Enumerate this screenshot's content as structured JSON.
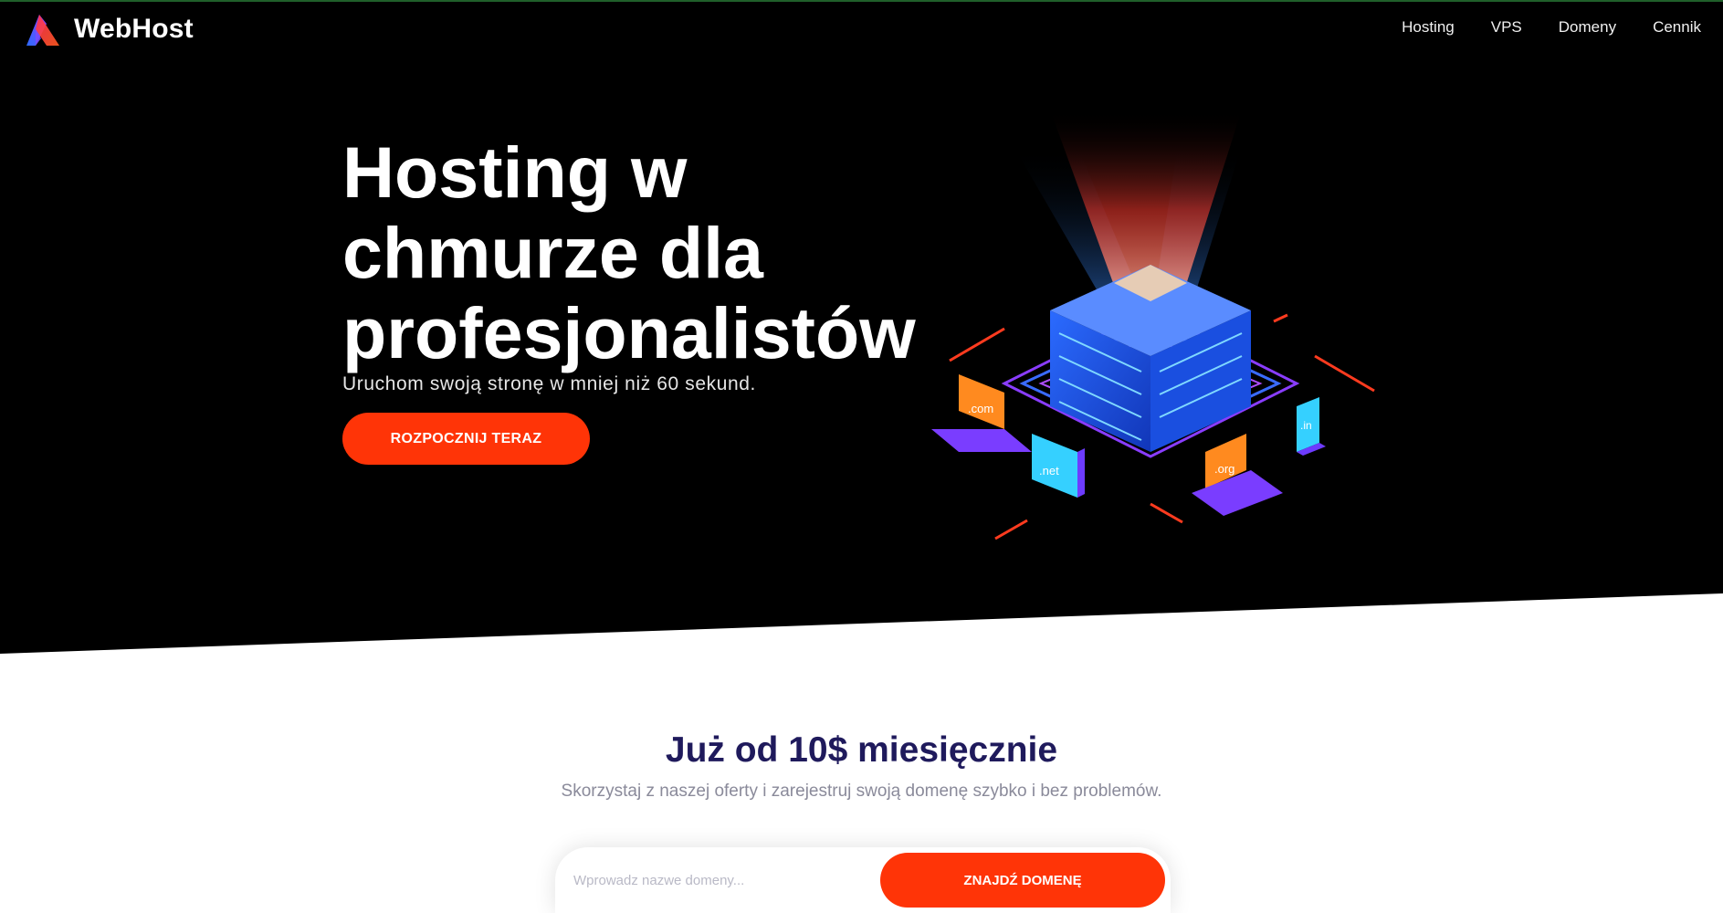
{
  "brand": {
    "name": "WebHost"
  },
  "nav": {
    "items": [
      {
        "label": "Hosting"
      },
      {
        "label": "VPS"
      },
      {
        "label": "Domeny"
      },
      {
        "label": "Cennik"
      }
    ]
  },
  "hero": {
    "title": "Hosting w chmurze dla profesjonalistów",
    "subtitle": "Uruchom swoją stronę w mniej niż 60 sekund.",
    "cta_label": "ROZPOCZNIJ TERAZ",
    "device_labels": {
      "laptop_left": ".com",
      "monitor": ".net",
      "laptop_right": ".org",
      "phone": ".in"
    }
  },
  "offer": {
    "title": "Już od 10$ miesięcznie",
    "subtitle": "Skorzystaj z naszej oferty i zarejestruj swoją domenę szybko i bez problemów."
  },
  "search": {
    "placeholder": "Wprowadz nazwe domeny...",
    "value": "",
    "button_label": "ZNAJDŹ DOMENĘ"
  },
  "colors": {
    "accent": "#ff3407",
    "hero_bg": "#000000",
    "offer_title": "#1f1a5c"
  }
}
